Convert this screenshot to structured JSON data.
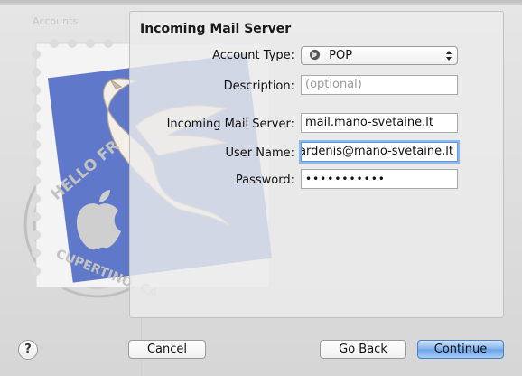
{
  "background": {
    "sidebar_header": "Accounts",
    "stamp_text_top": "HELLO FR",
    "stamp_text_bottom": "CUPERTINO, CA"
  },
  "pane": {
    "title": "Incoming Mail Server"
  },
  "form": {
    "account_type": {
      "label": "Account Type:",
      "value": "POP",
      "icon": "globe-icon"
    },
    "description": {
      "label": "Description:",
      "value": "",
      "placeholder": "(optional)"
    },
    "server": {
      "label": "Incoming Mail Server:",
      "value": "mail.mano-svetaine.lt"
    },
    "username": {
      "label": "User Name:",
      "value": "vardenis@mano-svetaine.lt"
    },
    "password": {
      "label": "Password:",
      "value": "•••••••••••"
    }
  },
  "buttons": {
    "help": "?",
    "cancel": "Cancel",
    "go_back": "Go Back",
    "continue": "Continue"
  },
  "colors": {
    "focus_ring": "#8ab8f0",
    "default_button": "#6aa3ea",
    "stamp_blue": "#5f78c9"
  }
}
